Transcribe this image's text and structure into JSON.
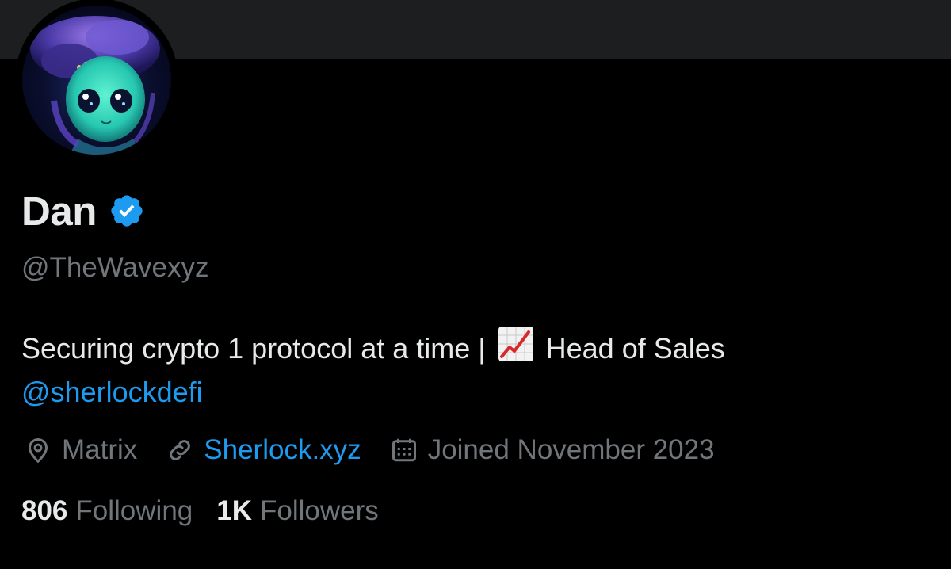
{
  "profile": {
    "display_name": "Dan",
    "verified": true,
    "handle": "@TheWavexyz",
    "avatar_icon": "avatar-image",
    "bio": {
      "text_before": "Securing crypto 1 protocol at a time | ",
      "emoji_icon": "chart-increasing-icon",
      "text_after": " Head of Sales",
      "mention": "@sherlockdefi"
    },
    "meta": {
      "location": "Matrix",
      "website": "Sherlock.xyz",
      "joined": "Joined November 2023"
    },
    "stats": {
      "following_count": "806",
      "following_label": "Following",
      "followers_count": "1K",
      "followers_label": "Followers"
    }
  },
  "colors": {
    "background": "#000000",
    "banner": "#1d1e20",
    "primary_text": "#e7e9ea",
    "secondary_text": "#71767b",
    "accent": "#1d9bf0"
  }
}
